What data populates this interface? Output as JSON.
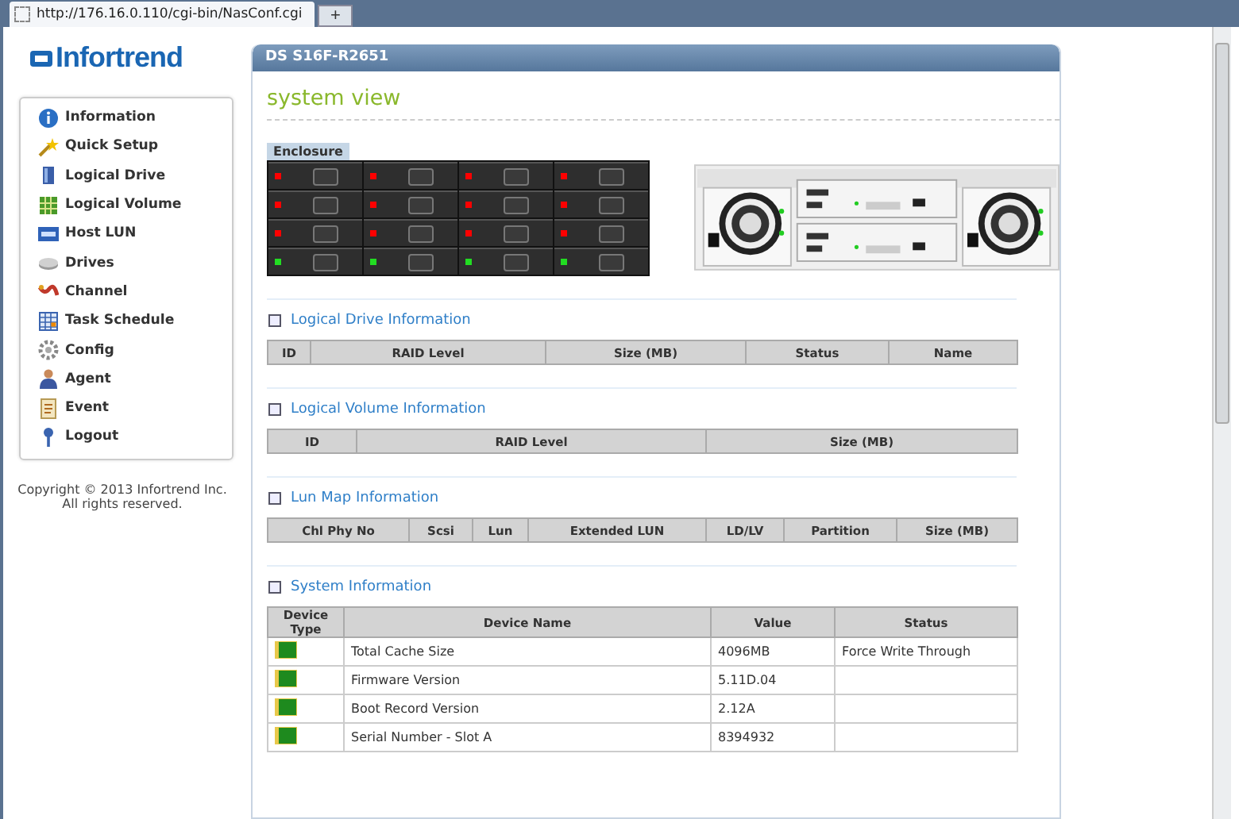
{
  "browser_tab": {
    "url": "http://176.16.0.110/cgi-bin/NasConf.cgi",
    "new_tab": "+"
  },
  "logo": "Infortrend",
  "sidebar": {
    "items": [
      {
        "label": "Information"
      },
      {
        "label": "Quick Setup"
      },
      {
        "label": "Logical Drive"
      },
      {
        "label": "Logical Volume"
      },
      {
        "label": "Host LUN"
      },
      {
        "label": "Drives"
      },
      {
        "label": "Channel"
      },
      {
        "label": "Task Schedule"
      },
      {
        "label": "Config"
      },
      {
        "label": "Agent"
      },
      {
        "label": "Event"
      },
      {
        "label": "Logout"
      }
    ],
    "copyright": [
      "Copyright © 2013 Infortrend Inc.",
      "All rights reserved."
    ]
  },
  "panel": {
    "title": "DS S16F-R2651",
    "heading": "system view",
    "enclosure_label": "Enclosure",
    "slots": [
      {
        "color": "#ff0000"
      },
      {
        "color": "#ff0000"
      },
      {
        "color": "#ff0000"
      },
      {
        "color": "#ff0000"
      },
      {
        "color": "#ff0000"
      },
      {
        "color": "#ff0000"
      },
      {
        "color": "#ff0000"
      },
      {
        "color": "#ff0000"
      },
      {
        "color": "#ff0000"
      },
      {
        "color": "#ff0000"
      },
      {
        "color": "#ff0000"
      },
      {
        "color": "#ff0000"
      },
      {
        "color": "#22dd22"
      },
      {
        "color": "#22dd22"
      },
      {
        "color": "#22dd22"
      },
      {
        "color": "#22dd22"
      }
    ],
    "sections": [
      {
        "title": "Logical Drive Information",
        "columns": [
          "ID",
          "RAID Level",
          "Size (MB)",
          "Status",
          "Name"
        ]
      },
      {
        "title": "Logical Volume Information",
        "columns": [
          "ID",
          "RAID Level",
          "Size (MB)"
        ]
      },
      {
        "title": "Lun Map Information",
        "columns": [
          "Chl Phy No",
          "Scsi",
          "Lun",
          "Extended LUN",
          "LD/LV",
          "Partition",
          "Size (MB)"
        ]
      },
      {
        "title": "System Information",
        "columns": [
          "Device Type",
          "Device Name",
          "Value",
          "Status"
        ],
        "rows": [
          [
            "",
            "Total Cache Size",
            "4096MB",
            "Force Write Through"
          ],
          [
            "",
            "Firmware Version",
            "5.11D.04",
            ""
          ],
          [
            "",
            "Boot Record Version",
            "2.12A",
            ""
          ],
          [
            "",
            "Serial Number - Slot A",
            "8394932",
            ""
          ]
        ]
      }
    ]
  }
}
